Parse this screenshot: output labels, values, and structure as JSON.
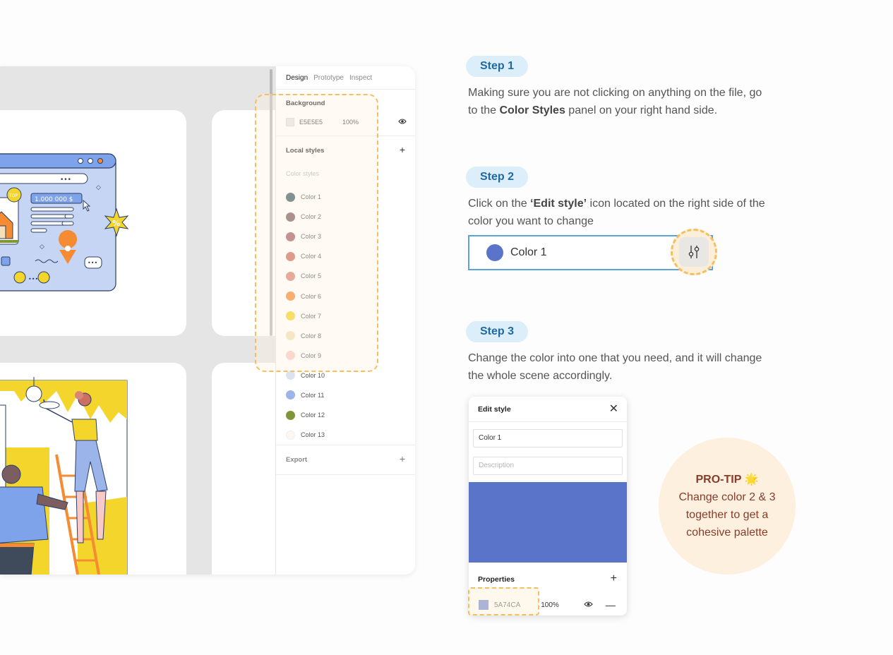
{
  "panel": {
    "tabs": [
      "Design",
      "Prototype",
      "Inspect"
    ],
    "background": {
      "title": "Background",
      "hex": "E5E5E5",
      "opacity": "100%"
    },
    "local_styles": {
      "title": "Local styles",
      "section_label": "Color styles",
      "colors": [
        {
          "name": "Color 1",
          "hex": "#3f5f6a"
        },
        {
          "name": "Color 2",
          "hex": "#7d5e60"
        },
        {
          "name": "Color 3",
          "hex": "#a75f69"
        },
        {
          "name": "Color 4",
          "hex": "#cc6e62"
        },
        {
          "name": "Color 5",
          "hex": "#d98577"
        },
        {
          "name": "Color 6",
          "hex": "#f58b33"
        },
        {
          "name": "Color 7",
          "hex": "#f3d52b"
        },
        {
          "name": "Color 8",
          "hex": "#f4dfb8"
        },
        {
          "name": "Color 9",
          "hex": "#f9c9c7"
        },
        {
          "name": "Color 10",
          "hex": "#dbe3f2"
        },
        {
          "name": "Color 11",
          "hex": "#9bb4ea"
        },
        {
          "name": "Color 12",
          "hex": "#7f9637"
        },
        {
          "name": "Color 13",
          "hex": "#fbf8f4"
        }
      ]
    },
    "export": {
      "title": "Export"
    }
  },
  "steps": {
    "s1": {
      "label": "Step 1",
      "text_before": "Making sure you are not clicking on anything on the file, go to the ",
      "bold": "Color Styles",
      "text_after": " panel on your right hand side."
    },
    "s2": {
      "label": "Step 2",
      "text_before": "Click on the ",
      "bold": "‘Edit style’",
      "text_after": " icon located on the right side of the color you want to change"
    },
    "s3": {
      "label": "Step 3",
      "text": "Change the color into one that you need, and it will change the whole scene accordingly."
    }
  },
  "color_bar": {
    "label": "Color 1",
    "color": "#5a74ca"
  },
  "dialog": {
    "title": "Edit style",
    "name_value": "Color 1",
    "description_placeholder": "Description",
    "color": "#5a74ca",
    "properties_title": "Properties",
    "hex": "5A74CA",
    "opacity": "100%"
  },
  "protip": {
    "head": "PRO-TIP",
    "emoji": "🌟",
    "body": "Change color 2 & 3 together to get a cohesive palette"
  }
}
